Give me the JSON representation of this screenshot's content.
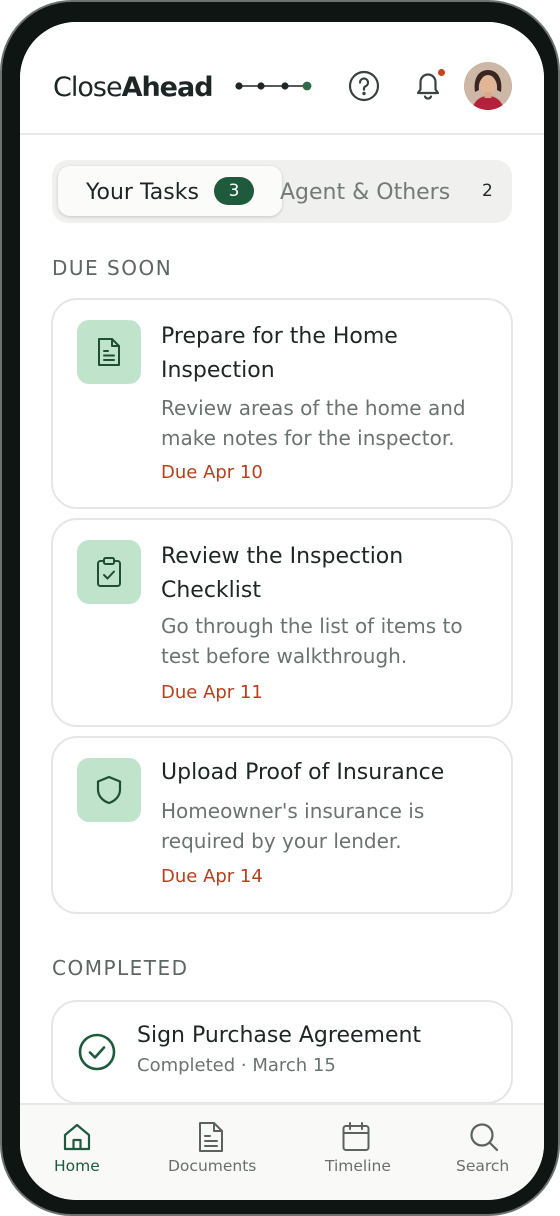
{
  "header": {
    "logo_light": "Close",
    "logo_bold": "Ahead"
  },
  "tabs": {
    "active_label": "Your Tasks",
    "active_count": "3",
    "inactive_label": "Agent & Others",
    "inactive_count": "2"
  },
  "due_soon": {
    "title": "DUE SOON",
    "tasks": [
      {
        "title": "Prepare for the Home Inspection",
        "description": "Review areas of the home and make notes for the inspector.",
        "due": "Due Apr 10",
        "icon": "document-icon"
      },
      {
        "title": "Review the Inspection Checklist",
        "description": "Go through the list of items to test before walkthrough.",
        "due": "Due Apr 11",
        "icon": "clipboard-check-icon"
      },
      {
        "title": "Upload Proof of Insurance",
        "description": "Homeowner's insurance is required by your lender.",
        "due": "Due Apr 14",
        "icon": "shield-icon"
      }
    ]
  },
  "completed": {
    "title": "COMPLETED",
    "tasks": [
      {
        "title": "Sign Purchase Agreement",
        "subtitle": "Completed · March 15",
        "icon": "check-circle-icon"
      }
    ]
  },
  "nav": {
    "items": [
      {
        "label": "Home",
        "icon": "home-icon",
        "active": true
      },
      {
        "label": "Documents",
        "icon": "document-icon",
        "active": false
      },
      {
        "label": "Timeline",
        "icon": "calendar-icon",
        "active": false
      },
      {
        "label": "Search",
        "icon": "search-icon",
        "active": false
      }
    ]
  },
  "colors": {
    "brand_green": "#1f5a3c",
    "icon_bg": "#bfe3cb",
    "due_red": "#b5401c",
    "notification_dot": "#c4451c"
  }
}
